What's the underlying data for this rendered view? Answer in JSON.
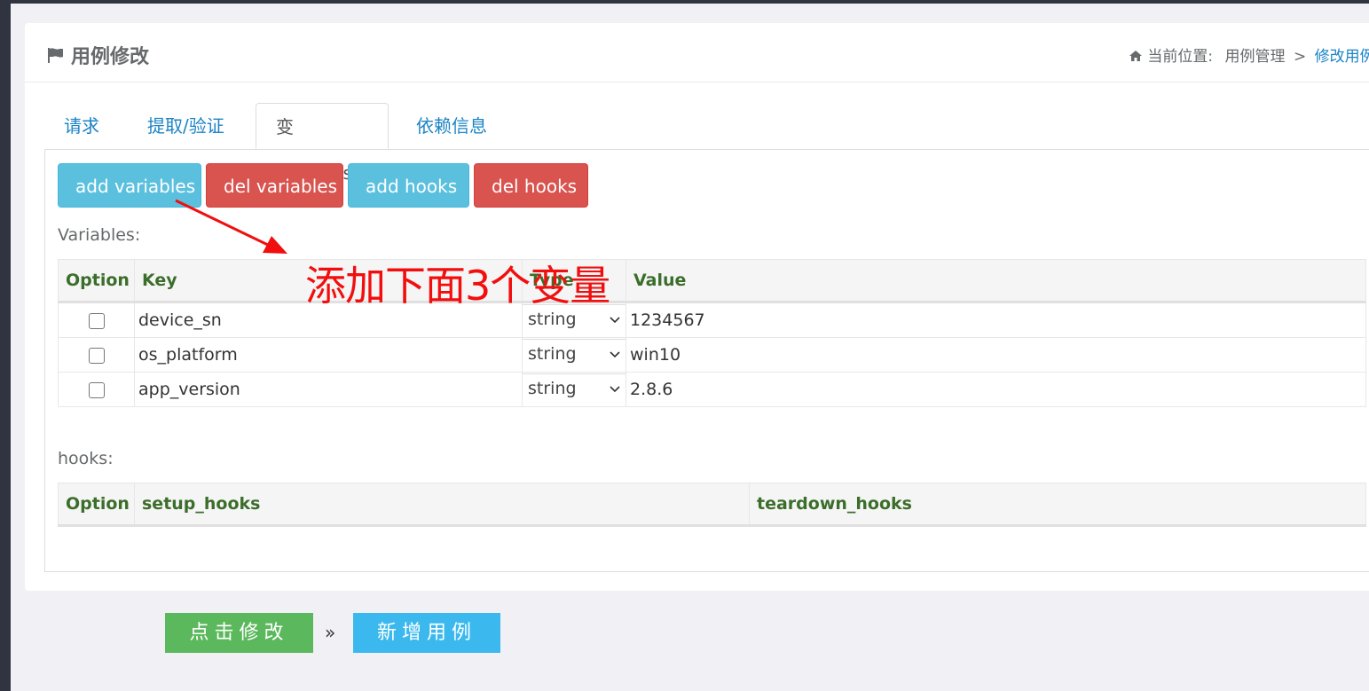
{
  "header": {
    "title": "用例修改",
    "breadcrumb": {
      "prefix": "当前位置:",
      "parent": "用例管理",
      "separator": ">",
      "current": "修改用例"
    }
  },
  "tabs": [
    {
      "label": "请求"
    },
    {
      "label": "提取/验证"
    },
    {
      "label": "变量/hooks"
    },
    {
      "label": "依赖信息"
    }
  ],
  "active_tab": "变量/hooks",
  "toolbar": {
    "add_variables": "add variables",
    "del_variables": "del variables",
    "add_hooks": "add hooks",
    "del_hooks": "del hooks"
  },
  "variables": {
    "label": "Variables:",
    "columns": {
      "option": "Option",
      "key": "Key",
      "type": "Type",
      "value": "Value"
    },
    "rows": [
      {
        "key": "device_sn",
        "type": "string",
        "value": "1234567",
        "checked": false
      },
      {
        "key": "os_platform",
        "type": "string",
        "value": "win10",
        "checked": false
      },
      {
        "key": "app_version",
        "type": "string",
        "value": "2.8.6",
        "checked": false
      }
    ]
  },
  "hooks": {
    "label": "hooks:",
    "columns": {
      "option": "Option",
      "setup": "setup_hooks",
      "teardown": "teardown_hooks"
    }
  },
  "annotation": {
    "text": "添加下面3个变量",
    "color": "#f20e0e"
  },
  "footer": {
    "submit_label": "点击修改",
    "separator": "»",
    "add_label": "新增用例"
  },
  "colors": {
    "info": "#5bc0de",
    "danger": "#d9534f",
    "success": "#5cb85c",
    "link": "#1c84c6",
    "header_green": "#3c6e2b"
  }
}
